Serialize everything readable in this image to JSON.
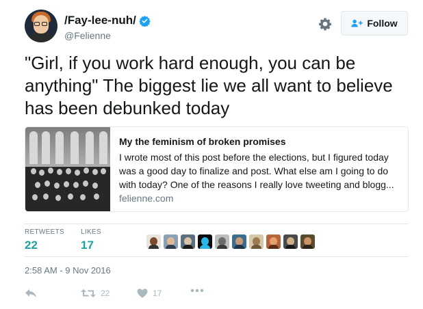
{
  "user": {
    "display_name": "/Fay-lee-nuh/",
    "handle": "@Felienne",
    "verified_color": "#1da1f2"
  },
  "header": {
    "settings_icon": "gear-icon",
    "follow_label": "Follow"
  },
  "tweet": {
    "text": "\"Girl, if you work hard enough, you can be anything\" The biggest lie we all want to believe has been debunked today"
  },
  "card": {
    "title": "My the feminism of broken promises",
    "description": "I wrote most of this post before the elections, but I figured today was a good day to finalize and post. What else am I going to do with today? One of the reasons I really love tweeting and blogg...",
    "domain": "felienne.com"
  },
  "stats": {
    "retweets_label": "RETWEETS",
    "retweets_count": "22",
    "likes_label": "LIKES",
    "likes_count": "17",
    "accent_color": "#1da1a1"
  },
  "timestamp": "2:58 AM - 9 Nov 2016",
  "actions": {
    "reply_icon": "reply-icon",
    "retweet_count": "22",
    "like_count": "17",
    "more_icon": "more-icon"
  }
}
